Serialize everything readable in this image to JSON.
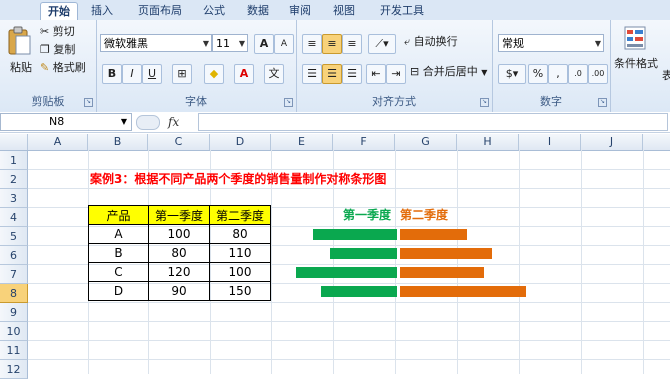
{
  "tabs": [
    "开始",
    "插入",
    "页面布局",
    "公式",
    "数据",
    "审阅",
    "视图",
    "开发工具"
  ],
  "clipboard": {
    "paste": "粘贴",
    "cut": "剪切",
    "copy": "复制",
    "format_painter": "格式刷",
    "label": "剪贴板"
  },
  "font": {
    "name": "微软雅黑",
    "size": "11",
    "label": "字体",
    "bold": "B",
    "italic": "I",
    "underline": "U",
    "grow": "A",
    "shrink": "A",
    "phonetic": "文",
    "font_color_glyph": "A",
    "fill_glyph": "◆"
  },
  "alignment": {
    "wrap": "自动换行",
    "merge": "合并后居中",
    "label": "对齐方式"
  },
  "number": {
    "format": "常规",
    "label": "数字",
    "percent": "%",
    "comma": ","
  },
  "styles": {
    "conditional": "条件格式",
    "table": "表"
  },
  "formula_bar": {
    "cell_ref": "N8",
    "fx": "fx",
    "formula": ""
  },
  "columns": [
    "A",
    "B",
    "C",
    "D",
    "E",
    "F",
    "G",
    "H",
    "I",
    "J"
  ],
  "rows": [
    "1",
    "2",
    "3",
    "4",
    "5",
    "6",
    "7",
    "8",
    "9",
    "10",
    "11",
    "12"
  ],
  "selected_row": "8",
  "sheet_title": "案例3：根据不同产品两个季度的销售量制作对称条形图",
  "table": {
    "headers": [
      "产品",
      "第一季度",
      "第二季度"
    ],
    "rows": [
      [
        "A",
        "100",
        "80"
      ],
      [
        "B",
        "80",
        "110"
      ],
      [
        "C",
        "120",
        "100"
      ],
      [
        "D",
        "90",
        "150"
      ]
    ]
  },
  "chart_data": {
    "type": "bar",
    "orientation": "horizontal-symmetric",
    "categories": [
      "A",
      "B",
      "C",
      "D"
    ],
    "series": [
      {
        "name": "第一季度",
        "values": [
          100,
          80,
          120,
          90
        ],
        "color": "#0aa84f"
      },
      {
        "name": "第二季度",
        "values": [
          80,
          110,
          100,
          150
        ],
        "color": "#e36c0a"
      }
    ]
  },
  "colors": {
    "title": "#ff0000",
    "header_fill": "#ffff00",
    "q1": "#0aa84f",
    "q2": "#e36c0a"
  }
}
